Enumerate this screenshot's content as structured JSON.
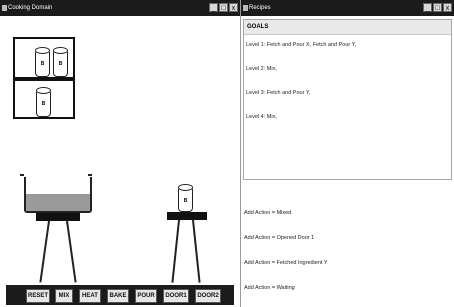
{
  "left_window": {
    "title": "Cooking Domain",
    "controls": [
      "_",
      "□",
      "x"
    ]
  },
  "shelf": {
    "top_jars": [
      "B",
      "B"
    ],
    "bottom_jars": [
      "B"
    ]
  },
  "counter_jar_label": "B",
  "buttons": [
    "RESET",
    "MIX",
    "HEAT",
    "BAKE",
    "POUR",
    "DOOR1",
    "DOOR2"
  ],
  "right_window": {
    "title": "Recipes",
    "controls": [
      "_",
      "□",
      "x"
    ],
    "goals_header": "GOALS",
    "goals": [
      "Level 1: Fetch and Pour X, Fetch and Pour Y,",
      "Level 2: Mix,",
      "Level 3: Fetch and Pour Y,",
      "Level 4: Mix,"
    ],
    "actions": [
      "Add Action = Mixed",
      "Add Action = Opened Door 1",
      "Add Action = Fetched Ingredient Y",
      "Add Action = Waiting"
    ]
  }
}
